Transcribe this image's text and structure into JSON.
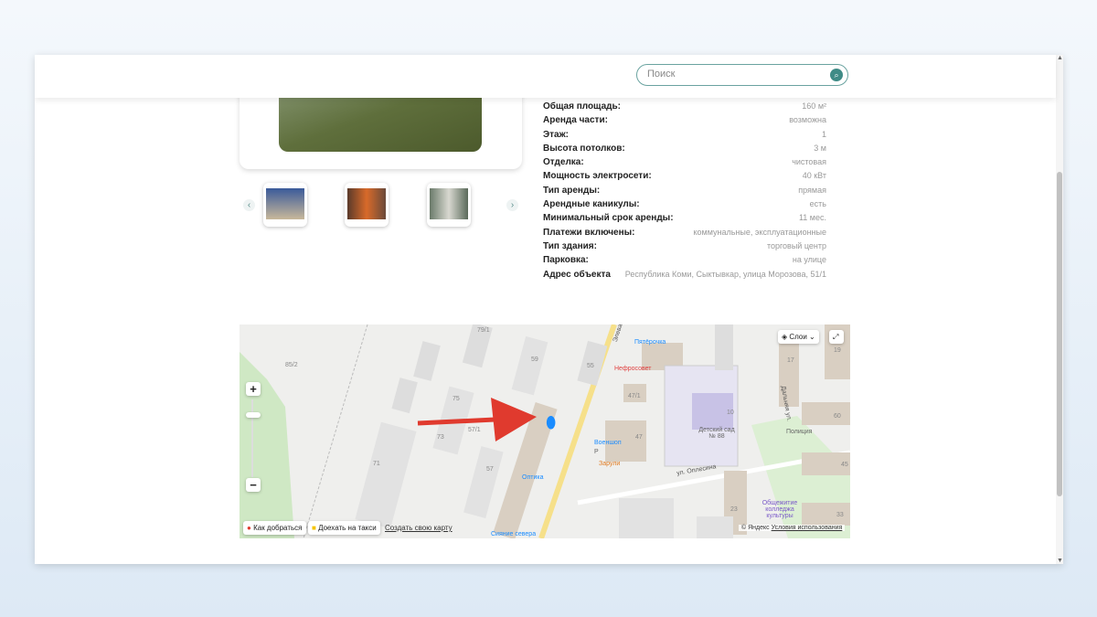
{
  "search": {
    "placeholder": "Поиск"
  },
  "properties": [
    {
      "label": "Общая площадь:",
      "value": "160 м²"
    },
    {
      "label": "Аренда части:",
      "value": "возможна"
    },
    {
      "label": "Этаж:",
      "value": "1"
    },
    {
      "label": "Высота потолков:",
      "value": "3 м"
    },
    {
      "label": "Отделка:",
      "value": "чистовая"
    },
    {
      "label": "Мощность электросети:",
      "value": "40 кВт"
    },
    {
      "label": "Тип аренды:",
      "value": "прямая"
    },
    {
      "label": "Арендные каникулы:",
      "value": "есть"
    },
    {
      "label": "Минимальный срок аренды:",
      "value": "11 мес."
    },
    {
      "label": "Платежи включены:",
      "value": "коммунальные, эксплуатационные"
    },
    {
      "label": "Тип здания:",
      "value": "торговый центр"
    },
    {
      "label": "Парковка:",
      "value": "на улице"
    },
    {
      "label": "Адрес объекта",
      "value": "Республика Коми, Сыктывкар, улица Морозова, 51/1"
    }
  ],
  "map": {
    "layers_label": "Слои",
    "route_label": "Как добраться",
    "taxi_label": "Доехать на такси",
    "create_map_label": "Создать свою карту",
    "copyright": "© Яндекс",
    "terms": "Условия использования",
    "places": {
      "pyaterochka": "Пятёрочка",
      "nefrosovet": "Нефросовет",
      "voenshop": "Военшоп",
      "zaruli": "Зарули",
      "optika": "Оптика",
      "siyanie": "Сияние севера",
      "kindergarten": "Детский сад № 88",
      "police": "Полиция",
      "dorm": "Общежитие колледжа культуры",
      "street1": "ул. Оплесина",
      "street2": "Дальняя ул.",
      "street3": "Элева",
      "parking": "P"
    },
    "numbers": {
      "n85_2": "85/2",
      "n79_1": "79/1",
      "n59": "59",
      "n55": "55",
      "n75": "75",
      "n57_1": "57/1",
      "n73": "73",
      "n71": "71",
      "n57": "57",
      "n47_1": "47/1",
      "n47": "47",
      "n10": "10",
      "n17": "17",
      "n60": "60",
      "n45": "45",
      "n23": "23",
      "n33": "33",
      "n19": "19"
    }
  }
}
